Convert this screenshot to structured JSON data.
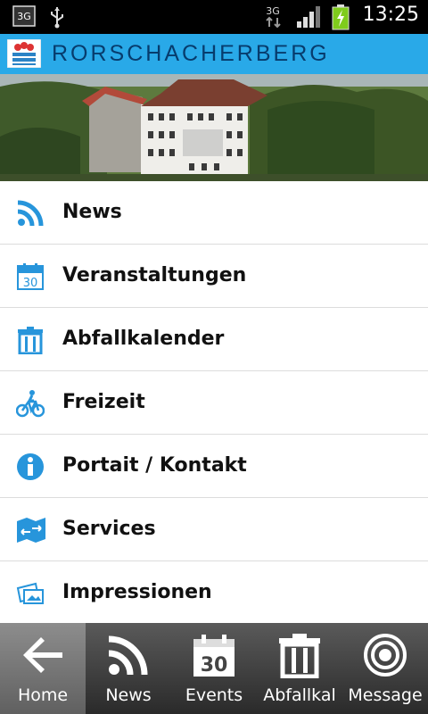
{
  "status_bar": {
    "network": "3G",
    "network2": "3G",
    "time": "13:25",
    "icons": [
      "sim-3g-icon",
      "usb-icon",
      "data-3g-icon",
      "signal-icon",
      "battery-charging-icon"
    ]
  },
  "header": {
    "brand": "RORSCHACHERBERG",
    "accent_color": "#29a9e8",
    "logo_icon": "crest-logo-icon"
  },
  "menu": {
    "items": [
      {
        "label": "News",
        "icon": "rss-icon"
      },
      {
        "label": "Veranstaltungen",
        "icon": "calendar-icon",
        "icon_text": "30"
      },
      {
        "label": "Abfallkalender",
        "icon": "trash-icon"
      },
      {
        "label": "Freizeit",
        "icon": "bicycle-icon"
      },
      {
        "label": "Portait / Kontakt",
        "icon": "info-icon"
      },
      {
        "label": "Services",
        "icon": "map-arrows-icon"
      },
      {
        "label": "Impressionen",
        "icon": "photos-icon"
      }
    ]
  },
  "tabbar": {
    "tabs": [
      {
        "label": "Home",
        "icon": "back-arrow-icon",
        "active": true
      },
      {
        "label": "News",
        "icon": "rss-icon",
        "active": false
      },
      {
        "label": "Events",
        "icon": "calendar-icon",
        "icon_text": "30",
        "active": false
      },
      {
        "label": "Abfallkal",
        "icon": "trash-icon",
        "active": false
      },
      {
        "label": "Message",
        "icon": "target-icon",
        "active": false
      }
    ]
  }
}
